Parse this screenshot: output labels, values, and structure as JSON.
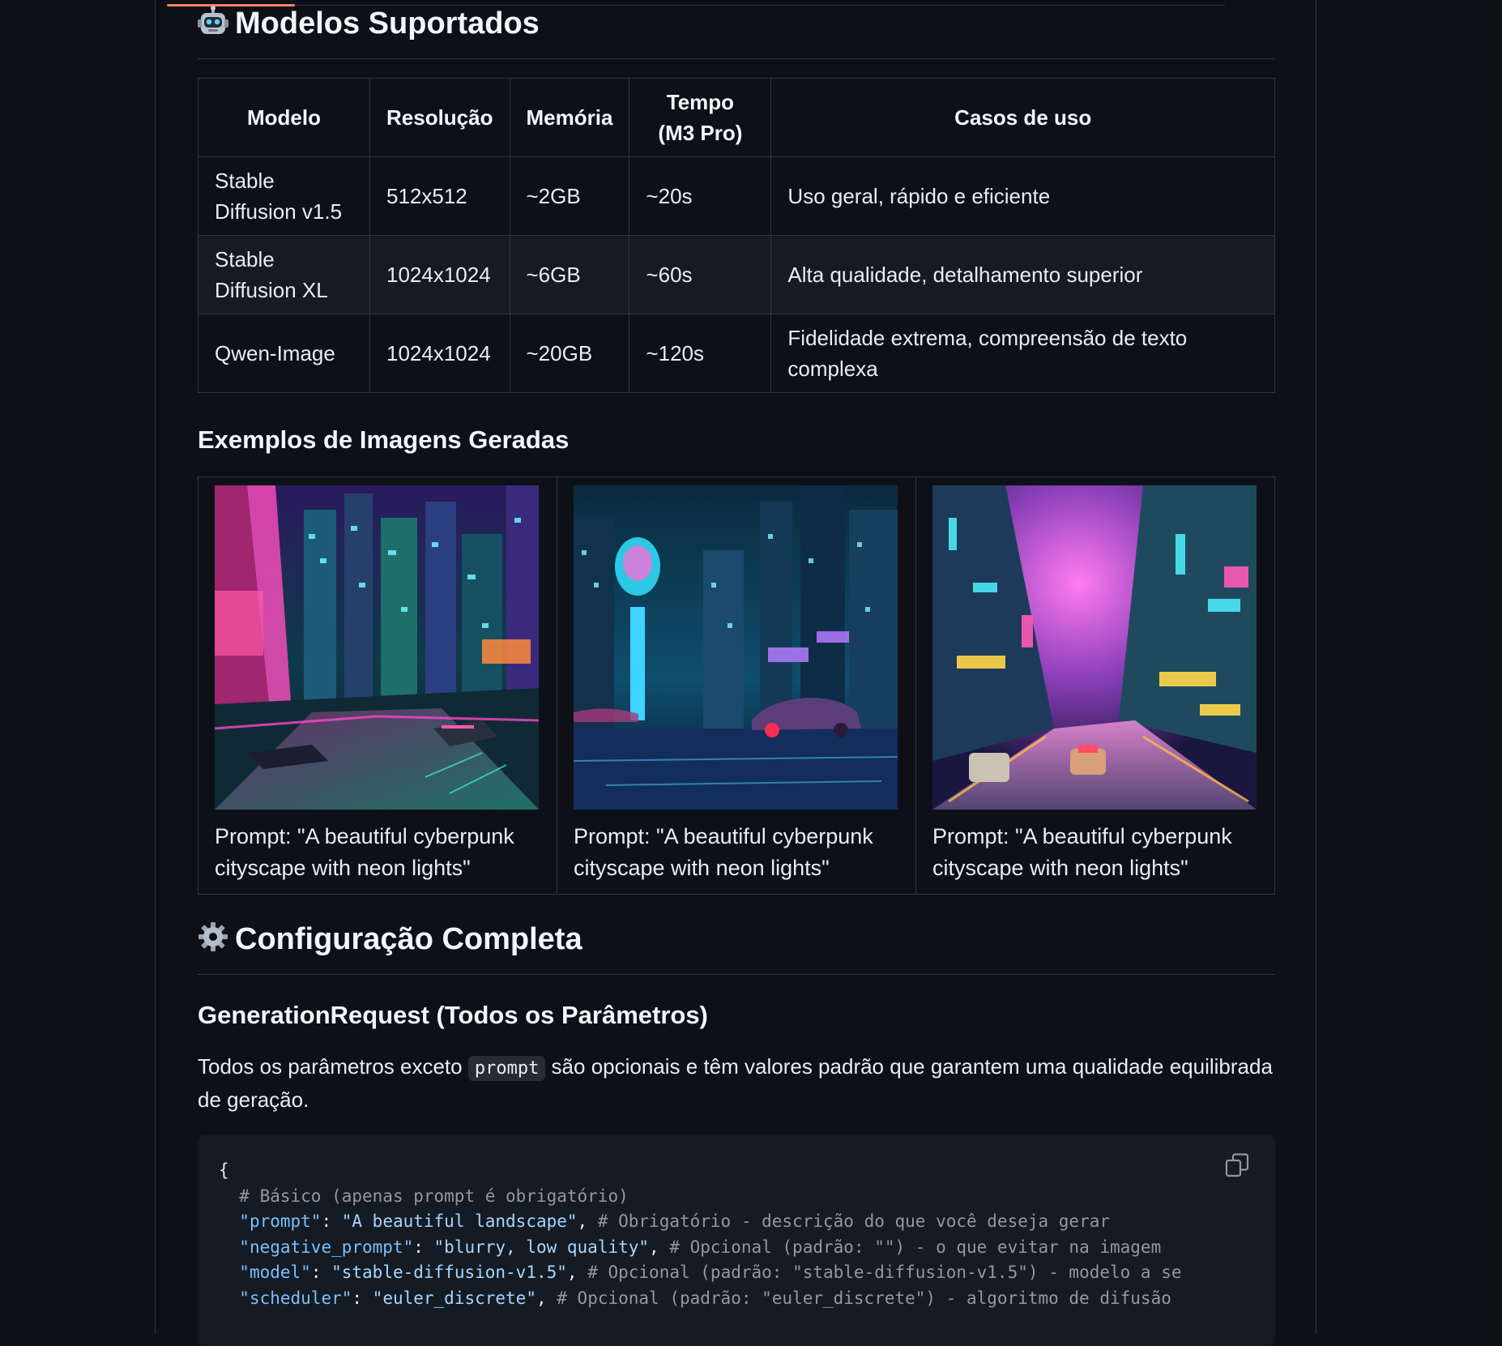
{
  "models_section": {
    "heading": "Modelos Suportados",
    "emoji_icon": "robot-icon",
    "table": {
      "headers": [
        "Modelo",
        "Resolução",
        "Memória",
        "Tempo (M3 Pro)",
        "Casos de uso"
      ],
      "rows": [
        [
          "Stable Diffusion v1.5",
          "512x512",
          "~2GB",
          "~20s",
          "Uso geral, rápido e eficiente"
        ],
        [
          "Stable Diffusion XL",
          "1024x1024",
          "~6GB",
          "~60s",
          "Alta qualidade, detalhamento superior"
        ],
        [
          "Qwen-Image",
          "1024x1024",
          "~20GB",
          "~120s",
          "Fidelidade extrema, compreensão de texto complexa"
        ]
      ]
    }
  },
  "examples_section": {
    "heading": "Exemplos de Imagens Geradas",
    "items": [
      {
        "caption": "Prompt: \"A beautiful cyberpunk cityscape with neon lights\"",
        "image": "cyberpunk-city-image-1"
      },
      {
        "caption": "Prompt: \"A beautiful cyberpunk cityscape with neon lights\"",
        "image": "cyberpunk-city-image-2"
      },
      {
        "caption": "Prompt: \"A beautiful cyberpunk cityscape with neon lights\"",
        "image": "cyberpunk-city-image-3"
      }
    ]
  },
  "config_section": {
    "heading": "Configuração Completa",
    "emoji_icon": "gear-icon",
    "subheading": "GenerationRequest (Todos os Parâmetros)",
    "desc_before": "Todos os parâmetros exceto ",
    "desc_code": "prompt",
    "desc_after": " são opcionais e têm valores padrão que garantem uma qualidade equilibrada de geração.",
    "code": {
      "open_brace": "{",
      "comment_basic": "# Básico (apenas prompt é obrigatório)",
      "lines": [
        {
          "key": "\"prompt\"",
          "value": "\"A beautiful landscape\"",
          "comment": "# Obrigatório - descrição do que você deseja gerar"
        },
        {
          "key": "\"negative_prompt\"",
          "value": "\"blurry, low quality\"",
          "comment": "# Opcional (padrão: \"\") - o que evitar na imagem"
        },
        {
          "key": "\"model\"",
          "value": "\"stable-diffusion-v1.5\"",
          "comment": "# Opcional (padrão: \"stable-diffusion-v1.5\") - modelo a se"
        },
        {
          "key": "\"scheduler\"",
          "value": "\"euler_discrete\"",
          "comment": "# Opcional (padrão: \"euler_discrete\") - algoritmo de difusão"
        }
      ],
      "copy_icon": "copy-icon"
    }
  }
}
